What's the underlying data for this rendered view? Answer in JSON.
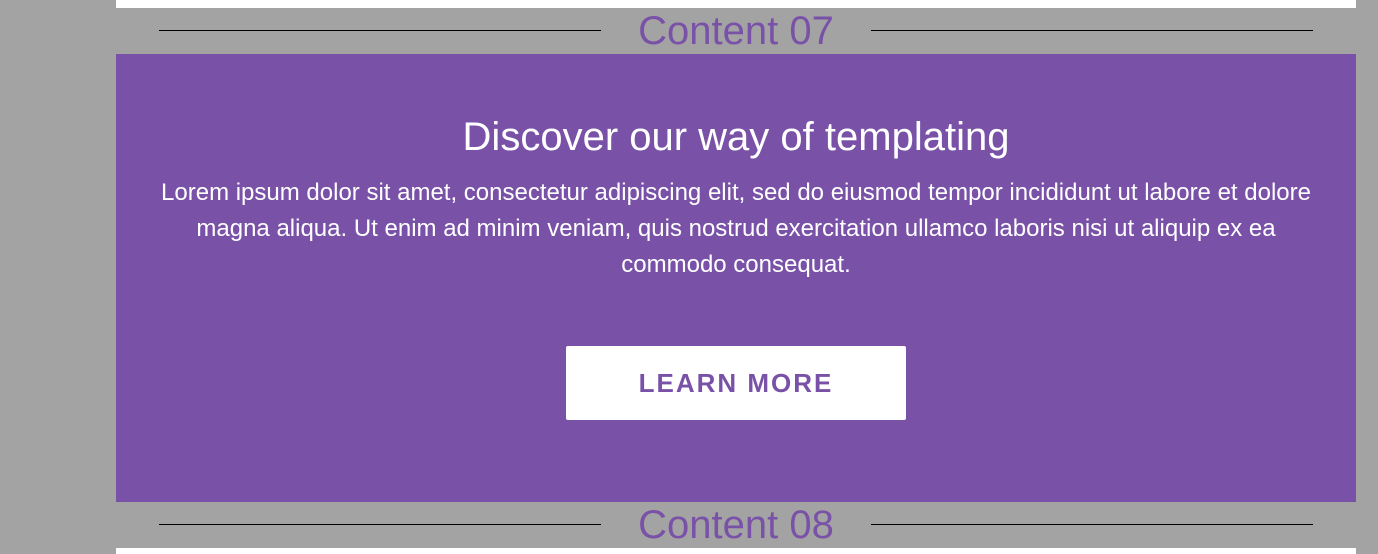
{
  "sections": [
    {
      "label": "Content 07"
    },
    {
      "label": "Content 08"
    }
  ],
  "hero": {
    "title": "Discover our way of templating",
    "text": "Lorem ipsum dolor sit amet, consectetur adipiscing elit, sed do eiusmod tempor incididunt ut labore et dolore magna aliqua. Ut enim ad minim veniam, quis nostrud exercitation ullamco laboris nisi ut aliquip ex ea commodo consequat.",
    "button_label": "LEARN MORE"
  },
  "colors": {
    "background": "#a3a3a3",
    "accent": "#7952a8",
    "button_bg": "#ffffff"
  }
}
